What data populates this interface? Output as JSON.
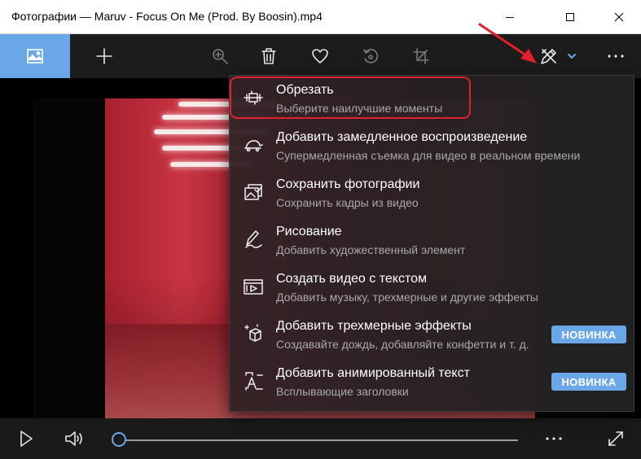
{
  "window": {
    "title": "Фотографии — Maruv - Focus On Me (Prod. By Boosin).mp4",
    "controls": [
      "minimize-icon",
      "maximize-icon",
      "close-icon"
    ]
  },
  "toolbar": {
    "tabs": [
      {
        "icon": "photo-icon",
        "active": true
      },
      {
        "icon": "plus-icon",
        "active": false
      }
    ],
    "actions": [
      "zoom-icon",
      "trash-icon",
      "heart-icon",
      "rotate-icon",
      "crop-icon"
    ],
    "edit_icon": "edit-create-icon",
    "dropdown_icon": "chevron-down-icon",
    "more_icon": "more-icon"
  },
  "menu": {
    "items": [
      {
        "title": "Обрезать",
        "subtitle": "Выберите наилучшие моменты",
        "icon": "trim-icon",
        "badge": "",
        "highlighted": true
      },
      {
        "title": "Добавить замедленное воспроизведение",
        "subtitle": "Супермедленная съемка для видео в реальном времени",
        "icon": "slow-motion-icon",
        "badge": ""
      },
      {
        "title": "Сохранить фотографии",
        "subtitle": "Сохранить кадры из видео",
        "icon": "save-photos-icon",
        "badge": ""
      },
      {
        "title": "Рисование",
        "subtitle": "Добавить художественный элемент",
        "icon": "draw-icon",
        "badge": ""
      },
      {
        "title": "Создать видео с текстом",
        "subtitle": "Добавить музыку, трехмерные и другие эффекты",
        "icon": "video-text-icon",
        "badge": ""
      },
      {
        "title": "Добавить трехмерные эффекты",
        "subtitle": "Создавайте дождь, добавляйте конфетти и т. д.",
        "icon": "3d-effects-icon",
        "badge": "НОВИНКА"
      },
      {
        "title": "Добавить анимированный текст",
        "subtitle": "Всплывающие заголовки",
        "icon": "animated-text-icon",
        "badge": "НОВИНКА"
      }
    ]
  },
  "player": {
    "play_icon": "play-icon",
    "volume_icon": "volume-icon",
    "more_icon": "more-icon",
    "fullscreen_icon": "fullscreen-icon",
    "progress": 0
  },
  "colors": {
    "accent": "#6aa7e6",
    "highlight_border": "#e0202c",
    "arrow": "#e0202c"
  }
}
